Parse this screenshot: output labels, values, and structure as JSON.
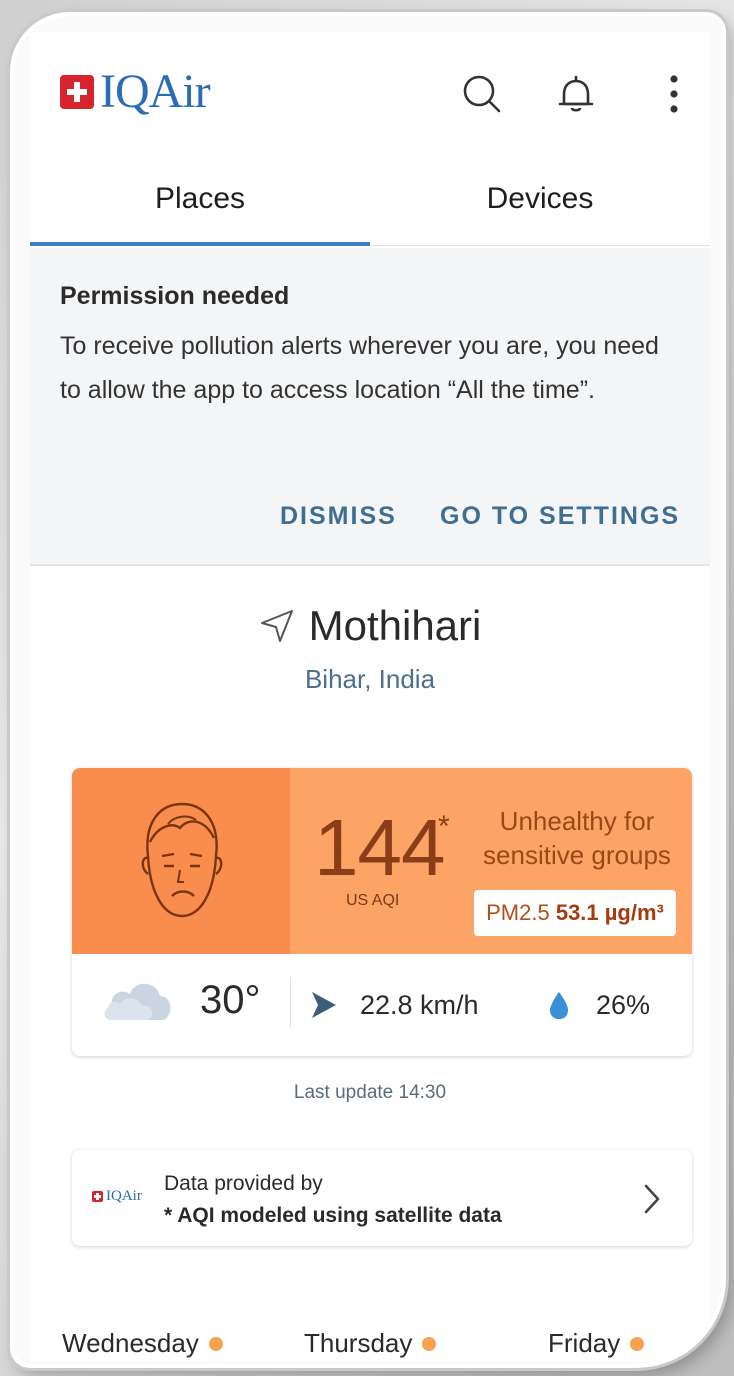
{
  "header": {
    "logo_text": "IQAir",
    "icons": [
      "search-icon",
      "bell-icon",
      "more-vert-icon"
    ]
  },
  "tabs": [
    {
      "label": "Places",
      "active": true
    },
    {
      "label": "Devices",
      "active": false
    }
  ],
  "banner": {
    "title": "Permission needed",
    "text": "To receive pollution alerts wherever you are, you need to allow the app to access location “All the time”.",
    "dismiss_label": "DISMISS",
    "settings_label": "GO TO SETTINGS"
  },
  "location": {
    "city": "Mothihari",
    "region": "Bihar, India"
  },
  "aqi": {
    "value": "144",
    "star": "*",
    "unit": "US AQI",
    "status": "Unhealthy for sensitive groups",
    "pollutant": "PM2.5",
    "concentration": "53.1 µg/m³",
    "colors": {
      "face_bg": "#f88d4d",
      "panel_bg": "#fca366"
    }
  },
  "weather": {
    "temperature": "30°",
    "wind": "22.8 km/h",
    "humidity": "26%"
  },
  "last_update": "Last update 14:30",
  "provider": {
    "logo_text": "IQAir",
    "line1": "Data provided by",
    "line2": "* AQI modeled using satellite data"
  },
  "forecast_days": [
    {
      "label": "Wednesday"
    },
    {
      "label": "Thursday"
    },
    {
      "label": "Friday"
    }
  ]
}
